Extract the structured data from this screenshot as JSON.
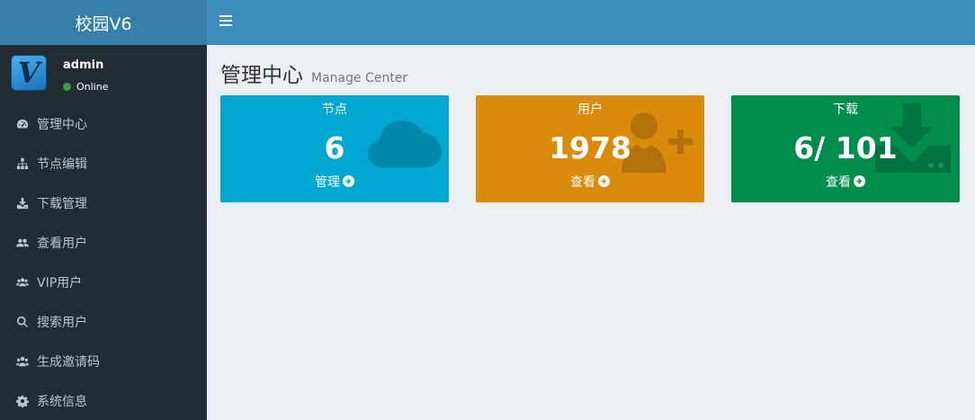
{
  "app": {
    "logo_text": "校园V6"
  },
  "user": {
    "name": "admin",
    "status": "Online",
    "avatar_letter": "V"
  },
  "sidebar": {
    "items": [
      {
        "label": "管理中心",
        "icon": "dashboard-icon"
      },
      {
        "label": "节点编辑",
        "icon": "sitemap-icon"
      },
      {
        "label": "下载管理",
        "icon": "download-icon"
      },
      {
        "label": "查看用户",
        "icon": "users-icon"
      },
      {
        "label": "VIP用户",
        "icon": "vip-users-icon"
      },
      {
        "label": "搜索用户",
        "icon": "search-icon"
      },
      {
        "label": "生成邀请码",
        "icon": "group-icon"
      },
      {
        "label": "系统信息",
        "icon": "gear-icon"
      }
    ]
  },
  "page": {
    "title": "管理中心",
    "subtitle": "Manage Center"
  },
  "cards": [
    {
      "label": "节点",
      "value": "6",
      "link": "管理",
      "color": "#00a7d0",
      "icon": "cloud-icon"
    },
    {
      "label": "用户",
      "value": "1978",
      "link": "查看",
      "color": "#db8b0b",
      "icon": "user-plus-icon"
    },
    {
      "label": "下载",
      "value": "6/ 101",
      "link": "查看",
      "color": "#008d4c",
      "icon": "download-drive-icon"
    }
  ],
  "colors": {
    "header": "#3c8dbc",
    "logo_bg": "#367fa9",
    "sidebar": "#222d32",
    "status_dot": "#3c9a41"
  }
}
